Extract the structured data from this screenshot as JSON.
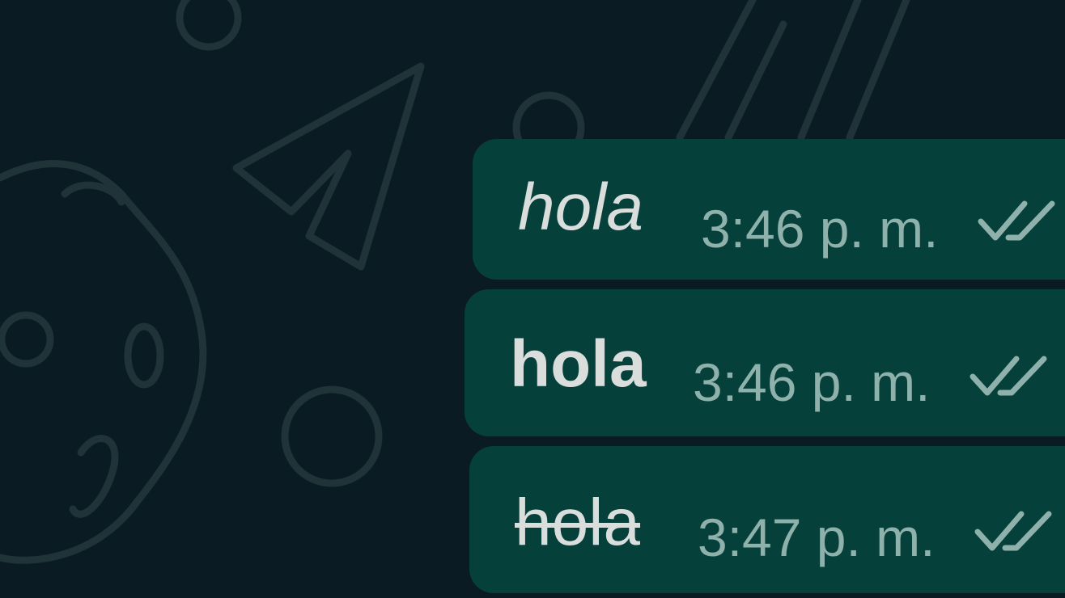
{
  "chat": {
    "messages": [
      {
        "text": "hola",
        "style": "italic",
        "time": "3:46 p. m.",
        "status_icon": "double-check-icon"
      },
      {
        "text": "hola",
        "style": "bold",
        "time": "3:46 p. m.",
        "status_icon": "double-check-icon"
      },
      {
        "text": "hola",
        "style": "strikethrough",
        "time": "3:47 p. m.",
        "status_icon": "double-check-icon"
      }
    ]
  },
  "colors": {
    "background": "#0b1b24",
    "wallpaper_doodles": "#1f3338",
    "outgoing_bubble": "#06403b",
    "message_text": "#d9dedc",
    "timestamp": "#8fb1ab"
  }
}
